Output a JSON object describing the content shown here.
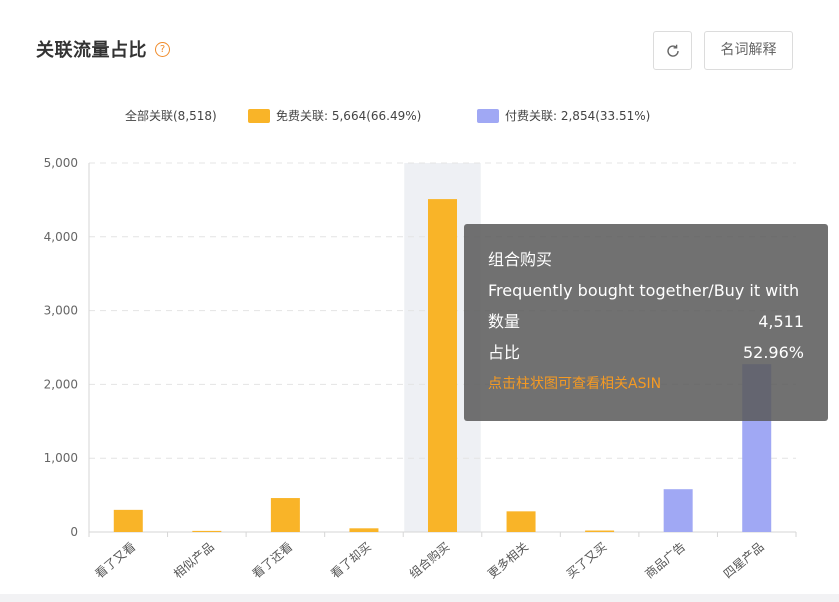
{
  "header": {
    "title": "关联流量占比",
    "help_glyph": "?",
    "glossary_label": "名词解释"
  },
  "legend": {
    "total": "全部关联(8,518)",
    "free": "免费关联: 5,664(66.49%)",
    "paid": "付费关联: 2,854(33.51%)"
  },
  "colors": {
    "free": "#f9b428",
    "paid": "#a0a8f4",
    "highlight": "#eef0f4",
    "accent": "#f08c2c"
  },
  "chart_data": {
    "type": "bar",
    "categories": [
      "看了又看",
      "相似产品",
      "看了还看",
      "看了却买",
      "组合购买",
      "更多相关",
      "买了又买",
      "商品广告",
      "四星产品"
    ],
    "series": [
      {
        "name": "免费关联",
        "values": [
          300,
          15,
          460,
          50,
          4511,
          280,
          20,
          null,
          null
        ]
      },
      {
        "name": "付费关联",
        "values": [
          null,
          null,
          null,
          null,
          null,
          null,
          null,
          580,
          2274
        ]
      }
    ],
    "y_ticks": [
      "0",
      "1,000",
      "2,000",
      "3,000",
      "4,000",
      "5,000"
    ],
    "ylim": [
      0,
      5000
    ],
    "highlighted_category": "组合购买",
    "grid": true,
    "legend_position": "top"
  },
  "tooltip": {
    "category": "组合购买",
    "category_en": "Frequently bought together/Buy it with",
    "count_label": "数量",
    "count_value": "4,511",
    "share_label": "占比",
    "share_value": "52.96%",
    "link_text": "点击柱状图可查看相关ASIN"
  }
}
